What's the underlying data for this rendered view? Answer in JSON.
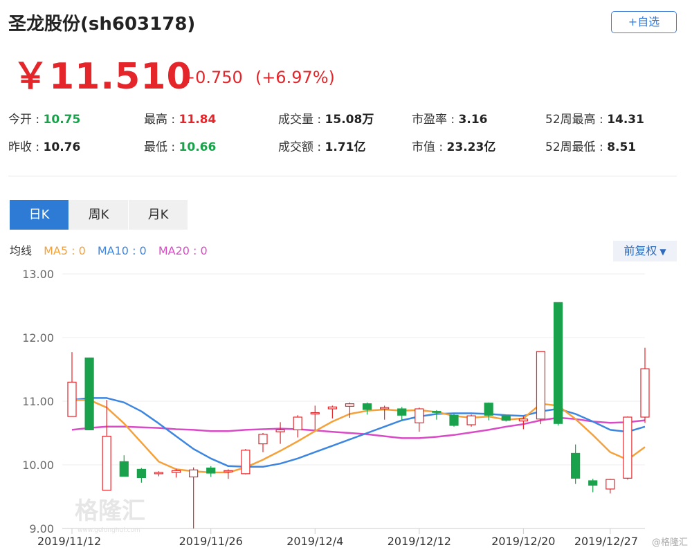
{
  "header": {
    "title": "圣龙股份(sh603178)",
    "add_label": "+自选"
  },
  "quote": {
    "price": "￥11.510",
    "change": "+0.750",
    "change_pct": "(+6.97%)"
  },
  "stats": [
    {
      "label": "今开",
      "value": "10.75",
      "tone": "down"
    },
    {
      "label": "昨收",
      "value": "10.76",
      "tone": "flat"
    },
    {
      "label": "最高",
      "value": "11.84",
      "tone": "up"
    },
    {
      "label": "最低",
      "value": "10.66",
      "tone": "down"
    },
    {
      "label": "成交量",
      "value": "15.08万",
      "tone": "flat"
    },
    {
      "label": "成交额",
      "value": "1.71亿",
      "tone": "flat"
    },
    {
      "label": "市盈率",
      "value": "3.16",
      "tone": "flat"
    },
    {
      "label": "市值",
      "value": "23.23亿",
      "tone": "flat"
    },
    {
      "label": "52周最高",
      "value": "14.31",
      "tone": "flat"
    },
    {
      "label": "52周最低",
      "value": "8.51",
      "tone": "flat"
    }
  ],
  "tabs": [
    "日K",
    "周K",
    "月K"
  ],
  "ma_legend": {
    "title": "均线",
    "ma5": "MA5 : 0",
    "ma10": "MA10 : 0",
    "ma20": "MA20 : 0"
  },
  "adjust_label": "前复权",
  "watermark": {
    "brand": "格隆汇",
    "url": "www.gelonghui.com",
    "corner": "@格隆汇"
  },
  "colors": {
    "up": "#e4262b",
    "down": "#1aa14b",
    "accent": "#2d7bd4",
    "ma5": "#f5a13a",
    "ma10": "#3d86e0",
    "ma20": "#d94bc6"
  },
  "chart_data": {
    "type": "candlestick",
    "ylim": [
      9.0,
      13.0
    ],
    "yticks": [
      "13.00",
      "12.00",
      "11.00",
      "10.00",
      "9.00"
    ],
    "xticks": [
      "2019/11/12",
      "2019/11/26",
      "2019/12/4",
      "2019/12/12",
      "2019/12/20",
      "2019/12/27"
    ],
    "xtick_index": [
      0,
      8,
      14,
      20,
      26,
      31
    ],
    "candles": [
      {
        "date": "2019/11/12",
        "open": 10.76,
        "close": 11.3,
        "high": 11.77,
        "low": 11.02
      },
      {
        "date": "2019/11/13",
        "open": 11.68,
        "close": 10.55,
        "high": 11.68,
        "low": 10.55
      },
      {
        "date": "2019/11/14",
        "open": 9.6,
        "close": 10.45,
        "high": 11.02,
        "low": 9.6
      },
      {
        "date": "2019/11/15",
        "open": 10.05,
        "close": 9.82,
        "high": 10.15,
        "low": 9.82
      },
      {
        "date": "2019/11/18",
        "open": 9.93,
        "close": 9.8,
        "high": 9.95,
        "low": 9.72
      },
      {
        "date": "2019/11/19",
        "open": 9.86,
        "close": 9.88,
        "high": 9.9,
        "low": 9.82
      },
      {
        "date": "2019/11/20",
        "open": 9.88,
        "close": 9.91,
        "high": 9.94,
        "low": 9.8
      },
      {
        "date": "2019/11/21",
        "open": 9.81,
        "close": 9.92,
        "high": 9.96,
        "low": 9.0
      },
      {
        "date": "2019/11/22",
        "open": 9.95,
        "close": 9.87,
        "high": 9.98,
        "low": 9.81
      },
      {
        "date": "2019/11/25",
        "open": 9.89,
        "close": 9.91,
        "high": 9.93,
        "low": 9.78
      },
      {
        "date": "2019/11/26",
        "open": 9.86,
        "close": 10.23,
        "high": 10.25,
        "low": 9.85
      },
      {
        "date": "2019/11/27",
        "open": 10.33,
        "close": 10.48,
        "high": 10.5,
        "low": 10.2
      },
      {
        "date": "2019/11/28",
        "open": 10.52,
        "close": 10.55,
        "high": 10.67,
        "low": 10.33
      },
      {
        "date": "2019/11/29",
        "open": 10.55,
        "close": 10.75,
        "high": 10.78,
        "low": 10.43
      },
      {
        "date": "2019/12/2",
        "open": 10.8,
        "close": 10.82,
        "high": 10.93,
        "low": 10.55
      },
      {
        "date": "2019/12/3",
        "open": 10.88,
        "close": 10.91,
        "high": 10.93,
        "low": 10.73
      },
      {
        "date": "2019/12/4",
        "open": 10.92,
        "close": 10.96,
        "high": 10.98,
        "low": 10.74
      },
      {
        "date": "2019/12/5",
        "open": 10.96,
        "close": 10.87,
        "high": 10.98,
        "low": 10.79
      },
      {
        "date": "2019/12/6",
        "open": 10.88,
        "close": 10.9,
        "high": 10.93,
        "low": 10.71
      },
      {
        "date": "2019/12/9",
        "open": 10.88,
        "close": 10.78,
        "high": 10.91,
        "low": 10.7
      },
      {
        "date": "2019/12/10",
        "open": 10.66,
        "close": 10.88,
        "high": 10.9,
        "low": 10.52
      },
      {
        "date": "2019/12/11",
        "open": 10.84,
        "close": 10.83,
        "high": 10.86,
        "low": 10.71
      },
      {
        "date": "2019/12/12",
        "open": 10.78,
        "close": 10.62,
        "high": 10.8,
        "low": 10.6
      },
      {
        "date": "2019/12/13",
        "open": 10.63,
        "close": 10.77,
        "high": 10.79,
        "low": 10.6
      },
      {
        "date": "2019/12/16",
        "open": 10.97,
        "close": 10.78,
        "high": 10.98,
        "low": 10.7
      },
      {
        "date": "2019/12/17",
        "open": 10.77,
        "close": 10.7,
        "high": 10.78,
        "low": 10.68
      },
      {
        "date": "2019/12/18",
        "open": 10.69,
        "close": 10.72,
        "high": 10.76,
        "low": 10.56
      },
      {
        "date": "2019/12/19",
        "open": 10.72,
        "close": 11.78,
        "high": 11.78,
        "low": 10.64
      },
      {
        "date": "2019/12/20",
        "open": 12.55,
        "close": 10.65,
        "high": 12.55,
        "low": 10.62
      },
      {
        "date": "2019/12/23",
        "open": 10.18,
        "close": 9.79,
        "high": 10.32,
        "low": 9.7
      },
      {
        "date": "2019/12/24",
        "open": 9.75,
        "close": 9.68,
        "high": 9.78,
        "low": 9.57
      },
      {
        "date": "2019/12/25",
        "open": 9.62,
        "close": 9.77,
        "high": 9.78,
        "low": 9.55
      },
      {
        "date": "2019/12/26",
        "open": 9.79,
        "close": 10.75,
        "high": 10.76,
        "low": 9.77
      },
      {
        "date": "2019/12/27",
        "open": 10.75,
        "close": 11.51,
        "high": 11.84,
        "low": 10.66
      }
    ],
    "ma5": [
      11.02,
      11.02,
      10.9,
      10.65,
      10.35,
      10.05,
      9.93,
      9.9,
      9.88,
      9.88,
      9.96,
      10.08,
      10.22,
      10.37,
      10.53,
      10.68,
      10.8,
      10.85,
      10.87,
      10.85,
      10.86,
      10.83,
      10.77,
      10.74,
      10.76,
      10.71,
      10.73,
      10.96,
      10.93,
      10.72,
      10.47,
      10.2,
      10.08,
      10.28
    ],
    "ma10": [
      11.02,
      11.05,
      11.05,
      10.98,
      10.84,
      10.65,
      10.45,
      10.25,
      10.1,
      9.98,
      9.97,
      9.97,
      10.02,
      10.1,
      10.2,
      10.3,
      10.4,
      10.5,
      10.6,
      10.7,
      10.76,
      10.8,
      10.81,
      10.81,
      10.8,
      10.78,
      10.77,
      10.84,
      10.88,
      10.8,
      10.68,
      10.55,
      10.52,
      10.6
    ],
    "ma20": [
      10.55,
      10.58,
      10.6,
      10.6,
      10.59,
      10.58,
      10.56,
      10.55,
      10.53,
      10.53,
      10.55,
      10.56,
      10.57,
      10.56,
      10.54,
      10.52,
      10.5,
      10.48,
      10.45,
      10.42,
      10.42,
      10.44,
      10.47,
      10.51,
      10.55,
      10.6,
      10.64,
      10.7,
      10.74,
      10.72,
      10.68,
      10.66,
      10.67,
      10.7
    ]
  }
}
